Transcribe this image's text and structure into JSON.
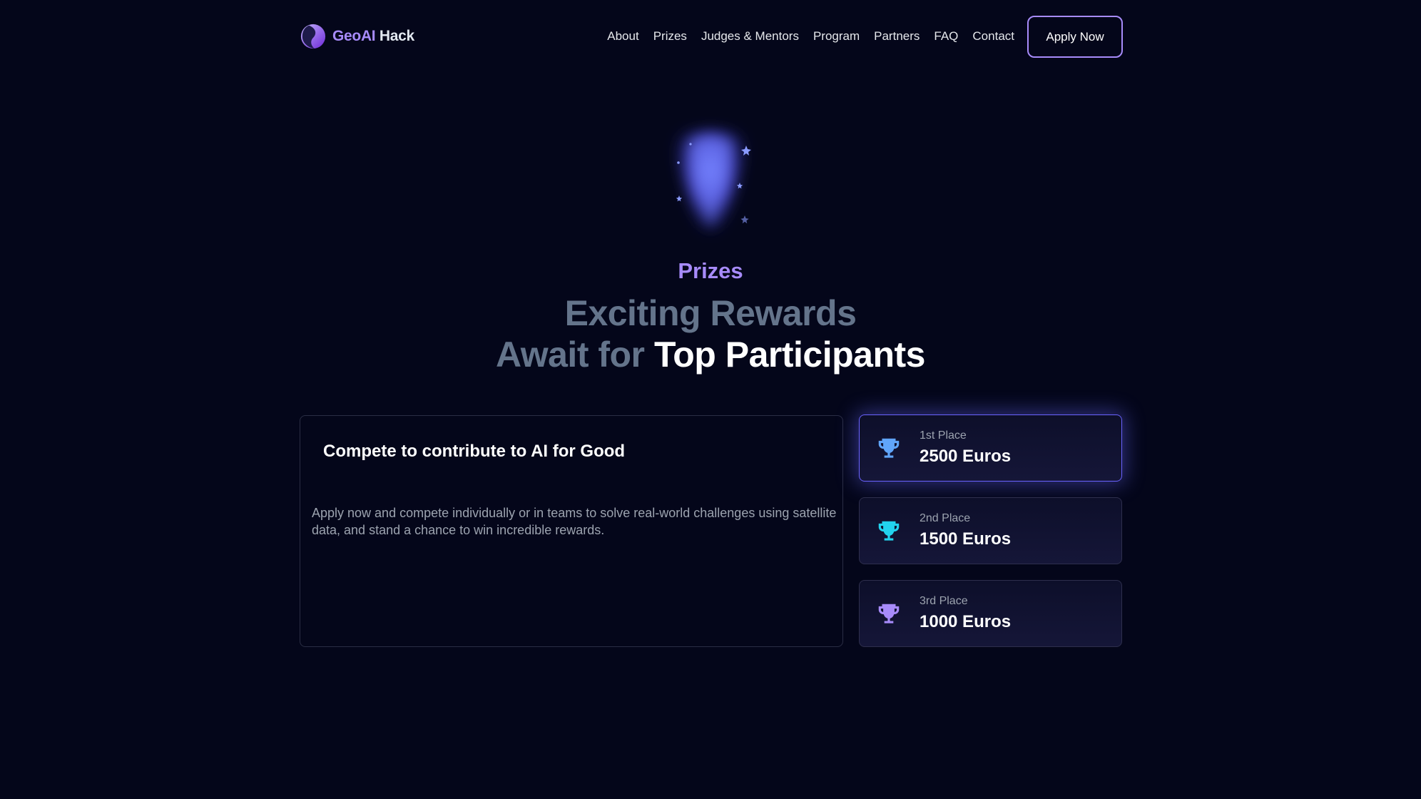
{
  "nav": {
    "logo": {
      "part1": "GeoAI",
      "part2": "Hack"
    },
    "links": [
      "About",
      "Prizes",
      "Judges & Mentors",
      "Program",
      "Partners",
      "FAQ",
      "Contact"
    ],
    "cta": "Apply Now"
  },
  "hero": {
    "eyebrow": "Prizes",
    "headline_line1": "Exciting Rewards",
    "headline_line2_muted": "Await for",
    "headline_line2_bright": "Top Participants",
    "icon": "glowing-trophy-icon"
  },
  "info": {
    "title": "Compete to contribute to AI for Good",
    "body": "Apply now and compete individually or in teams to solve real-world challenges using satellite data, and stand a chance to win incredible rewards."
  },
  "prizes": [
    {
      "place": "1st Place",
      "amount": "2500 Euros",
      "color": "#60a5fa"
    },
    {
      "place": "2nd Place",
      "amount": "1500 Euros",
      "color": "#22d3ee"
    },
    {
      "place": "3rd Place",
      "amount": "1000 Euros",
      "color": "#a78bfa"
    }
  ],
  "colors": {
    "background": "#04061a",
    "accent": "#a78bfa",
    "muted_heading": "#64748b",
    "glow": "#6366f1"
  }
}
